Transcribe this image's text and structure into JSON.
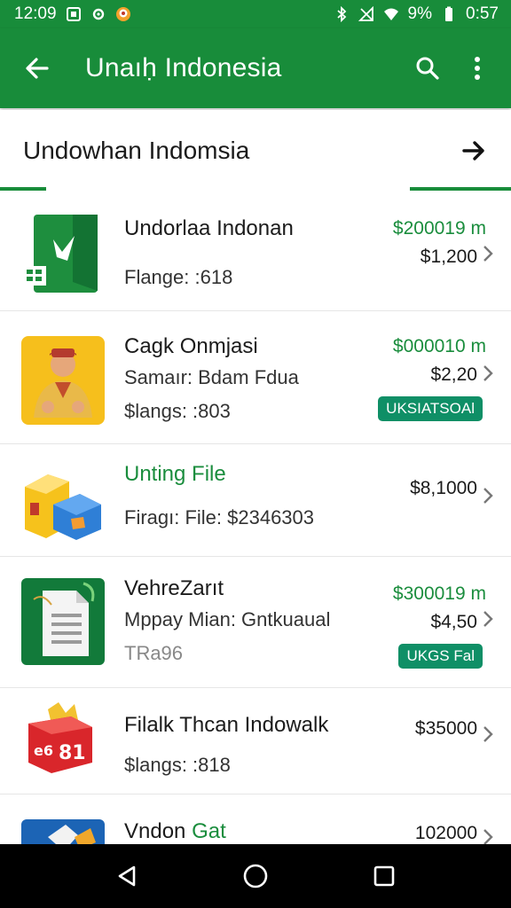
{
  "status_bar": {
    "time_left": "12:09",
    "battery_percent": "9%",
    "time_right": "0:57",
    "icons": [
      "screenshot-icon",
      "settings-icon",
      "avatar-icon",
      "bluetooth-icon",
      "no-signal-icon",
      "wifi-icon",
      "battery-icon"
    ]
  },
  "app_bar": {
    "title": "Unaıḥ Indonesia",
    "back_icon": "arrow-back-icon",
    "search_icon": "search-icon",
    "menu_icon": "more-vert-icon"
  },
  "sub_header": {
    "title": "Undowhan Indomsia",
    "forward_icon": "arrow-forward-icon"
  },
  "items": [
    {
      "name": "Undorlaa Indonan",
      "line1": "Flange: :618",
      "line2": "",
      "price_top": "$200019 m",
      "price_bottom": "$1,200",
      "badge": "",
      "icon": "green-document-icon"
    },
    {
      "name": "Cagk Onmjasi",
      "line1": "Samaır: Bdam Fdua",
      "line2": "$langs: :803",
      "price_top": "$000010 m",
      "price_bottom": "$2,20",
      "badge": "UKSIATSOAl",
      "icon": "person-illustration-icon"
    },
    {
      "name": "Unting File",
      "line1": "Firagı: File: $2346303",
      "line2": "",
      "price_top": "",
      "price_bottom": "$8,1000",
      "badge": "",
      "icon": "boxes-icon"
    },
    {
      "name": "VehreZarıt",
      "line1": "Mppay Mian: Gntkuaual",
      "line2": "TRa96",
      "price_top": "$300019 m",
      "price_bottom": "$4,50",
      "badge": "UKGS Fal",
      "icon": "file-document-icon"
    },
    {
      "name": "Filalk Thcan Indowalk",
      "line1": "$langs: :818",
      "line2": "",
      "price_top": "",
      "price_bottom": "$35000",
      "badge": "",
      "icon": "red-box-icon"
    },
    {
      "name_part1": "Vndon",
      "name_part2": " Gat",
      "line1": "",
      "line2": "",
      "price_top": "",
      "price_bottom": "102000",
      "badge": "",
      "icon": "blue-image-icon"
    }
  ],
  "nav_bar": {
    "back_icon": "nav-back-icon",
    "home_icon": "nav-home-icon",
    "recents_icon": "nav-recents-icon"
  },
  "colors": {
    "primary": "#188c3a",
    "accent_text": "#1a8d3d",
    "badge": "#0f8f66"
  }
}
